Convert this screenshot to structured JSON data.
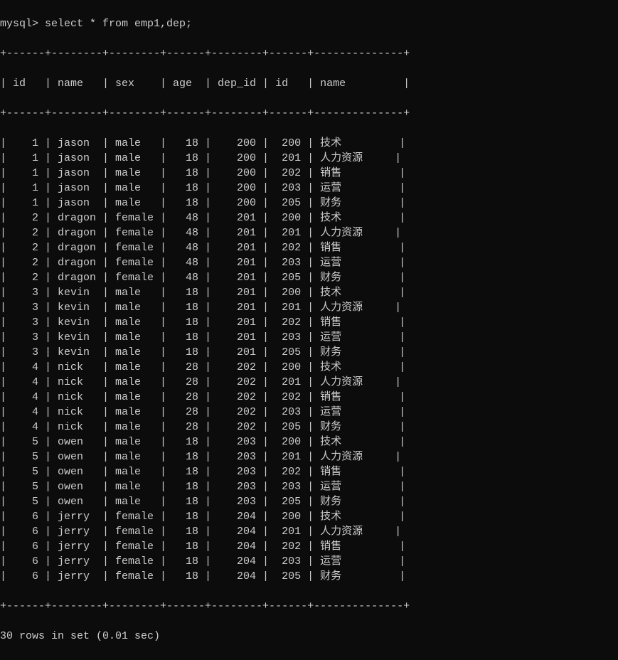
{
  "prompt": "mysql> select * from emp1,dep;",
  "headers": [
    "id",
    "name",
    "sex",
    "age",
    "dep_id",
    "id",
    "name"
  ],
  "rows": [
    {
      "id1": "1",
      "name1": "jason",
      "sex": "male",
      "age": "18",
      "dep_id": "200",
      "id2": "200",
      "name2": "技术"
    },
    {
      "id1": "1",
      "name1": "jason",
      "sex": "male",
      "age": "18",
      "dep_id": "200",
      "id2": "201",
      "name2": "人力资源"
    },
    {
      "id1": "1",
      "name1": "jason",
      "sex": "male",
      "age": "18",
      "dep_id": "200",
      "id2": "202",
      "name2": "销售"
    },
    {
      "id1": "1",
      "name1": "jason",
      "sex": "male",
      "age": "18",
      "dep_id": "200",
      "id2": "203",
      "name2": "运营"
    },
    {
      "id1": "1",
      "name1": "jason",
      "sex": "male",
      "age": "18",
      "dep_id": "200",
      "id2": "205",
      "name2": "财务"
    },
    {
      "id1": "2",
      "name1": "dragon",
      "sex": "female",
      "age": "48",
      "dep_id": "201",
      "id2": "200",
      "name2": "技术"
    },
    {
      "id1": "2",
      "name1": "dragon",
      "sex": "female",
      "age": "48",
      "dep_id": "201",
      "id2": "201",
      "name2": "人力资源"
    },
    {
      "id1": "2",
      "name1": "dragon",
      "sex": "female",
      "age": "48",
      "dep_id": "201",
      "id2": "202",
      "name2": "销售"
    },
    {
      "id1": "2",
      "name1": "dragon",
      "sex": "female",
      "age": "48",
      "dep_id": "201",
      "id2": "203",
      "name2": "运营"
    },
    {
      "id1": "2",
      "name1": "dragon",
      "sex": "female",
      "age": "48",
      "dep_id": "201",
      "id2": "205",
      "name2": "财务"
    },
    {
      "id1": "3",
      "name1": "kevin",
      "sex": "male",
      "age": "18",
      "dep_id": "201",
      "id2": "200",
      "name2": "技术"
    },
    {
      "id1": "3",
      "name1": "kevin",
      "sex": "male",
      "age": "18",
      "dep_id": "201",
      "id2": "201",
      "name2": "人力资源"
    },
    {
      "id1": "3",
      "name1": "kevin",
      "sex": "male",
      "age": "18",
      "dep_id": "201",
      "id2": "202",
      "name2": "销售"
    },
    {
      "id1": "3",
      "name1": "kevin",
      "sex": "male",
      "age": "18",
      "dep_id": "201",
      "id2": "203",
      "name2": "运营"
    },
    {
      "id1": "3",
      "name1": "kevin",
      "sex": "male",
      "age": "18",
      "dep_id": "201",
      "id2": "205",
      "name2": "财务"
    },
    {
      "id1": "4",
      "name1": "nick",
      "sex": "male",
      "age": "28",
      "dep_id": "202",
      "id2": "200",
      "name2": "技术"
    },
    {
      "id1": "4",
      "name1": "nick",
      "sex": "male",
      "age": "28",
      "dep_id": "202",
      "id2": "201",
      "name2": "人力资源"
    },
    {
      "id1": "4",
      "name1": "nick",
      "sex": "male",
      "age": "28",
      "dep_id": "202",
      "id2": "202",
      "name2": "销售"
    },
    {
      "id1": "4",
      "name1": "nick",
      "sex": "male",
      "age": "28",
      "dep_id": "202",
      "id2": "203",
      "name2": "运营"
    },
    {
      "id1": "4",
      "name1": "nick",
      "sex": "male",
      "age": "28",
      "dep_id": "202",
      "id2": "205",
      "name2": "财务"
    },
    {
      "id1": "5",
      "name1": "owen",
      "sex": "male",
      "age": "18",
      "dep_id": "203",
      "id2": "200",
      "name2": "技术"
    },
    {
      "id1": "5",
      "name1": "owen",
      "sex": "male",
      "age": "18",
      "dep_id": "203",
      "id2": "201",
      "name2": "人力资源"
    },
    {
      "id1": "5",
      "name1": "owen",
      "sex": "male",
      "age": "18",
      "dep_id": "203",
      "id2": "202",
      "name2": "销售"
    },
    {
      "id1": "5",
      "name1": "owen",
      "sex": "male",
      "age": "18",
      "dep_id": "203",
      "id2": "203",
      "name2": "运营"
    },
    {
      "id1": "5",
      "name1": "owen",
      "sex": "male",
      "age": "18",
      "dep_id": "203",
      "id2": "205",
      "name2": "财务"
    },
    {
      "id1": "6",
      "name1": "jerry",
      "sex": "female",
      "age": "18",
      "dep_id": "204",
      "id2": "200",
      "name2": "技术"
    },
    {
      "id1": "6",
      "name1": "jerry",
      "sex": "female",
      "age": "18",
      "dep_id": "204",
      "id2": "201",
      "name2": "人力资源"
    },
    {
      "id1": "6",
      "name1": "jerry",
      "sex": "female",
      "age": "18",
      "dep_id": "204",
      "id2": "202",
      "name2": "销售"
    },
    {
      "id1": "6",
      "name1": "jerry",
      "sex": "female",
      "age": "18",
      "dep_id": "204",
      "id2": "203",
      "name2": "运营"
    },
    {
      "id1": "6",
      "name1": "jerry",
      "sex": "female",
      "age": "18",
      "dep_id": "204",
      "id2": "205",
      "name2": "财务"
    }
  ],
  "footer": "30 rows in set (0.01 sec)",
  "border": "+------+--------+--------+------+--------+------+--------------+"
}
